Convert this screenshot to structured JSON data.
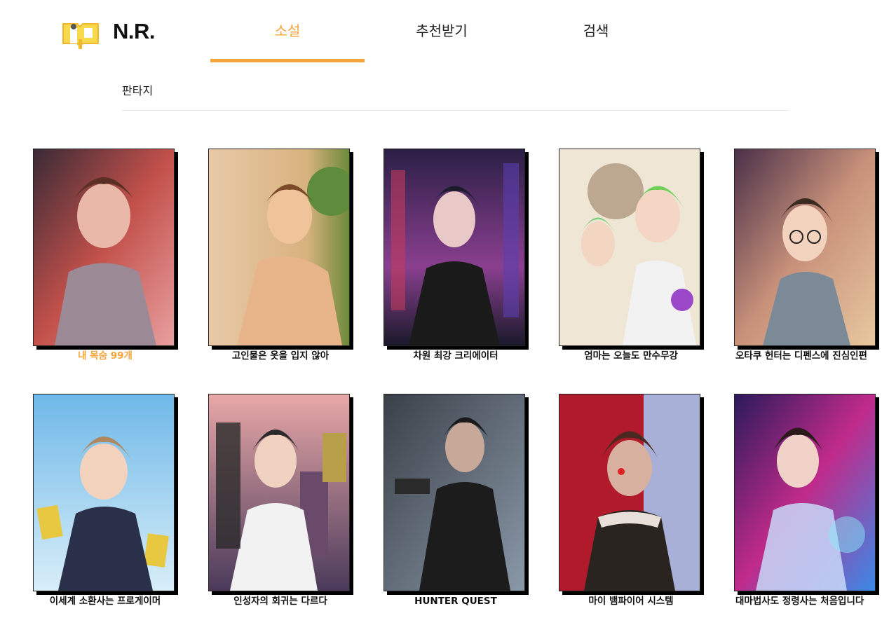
{
  "brand": {
    "name": "N.R.",
    "logo": "book-logo-icon"
  },
  "nav": {
    "tabs": [
      {
        "label": "소설",
        "active": true
      },
      {
        "label": "추천받기",
        "active": false
      },
      {
        "label": "검색",
        "active": false
      }
    ]
  },
  "subcategory": "판타지",
  "colors": {
    "accent": "#f5a53c"
  },
  "novels": [
    {
      "title": "내 목숨 99개",
      "highlighted": true
    },
    {
      "title": "고인물은 옷을 입지 않아"
    },
    {
      "title": "차원 최강 크리에이터"
    },
    {
      "title": "엄마는 오늘도 만수무강"
    },
    {
      "title": "오타쿠 헌터는 디펜스에 진심인편"
    },
    {
      "title": "이세계 소환사는 프로게이머"
    },
    {
      "title": "인성자의 회귀는 다르다"
    },
    {
      "title": "HUNTER QUEST"
    },
    {
      "title": "마이 뱀파이어 시스템"
    },
    {
      "title": "대마법사도 정령사는 처음입니다"
    }
  ]
}
